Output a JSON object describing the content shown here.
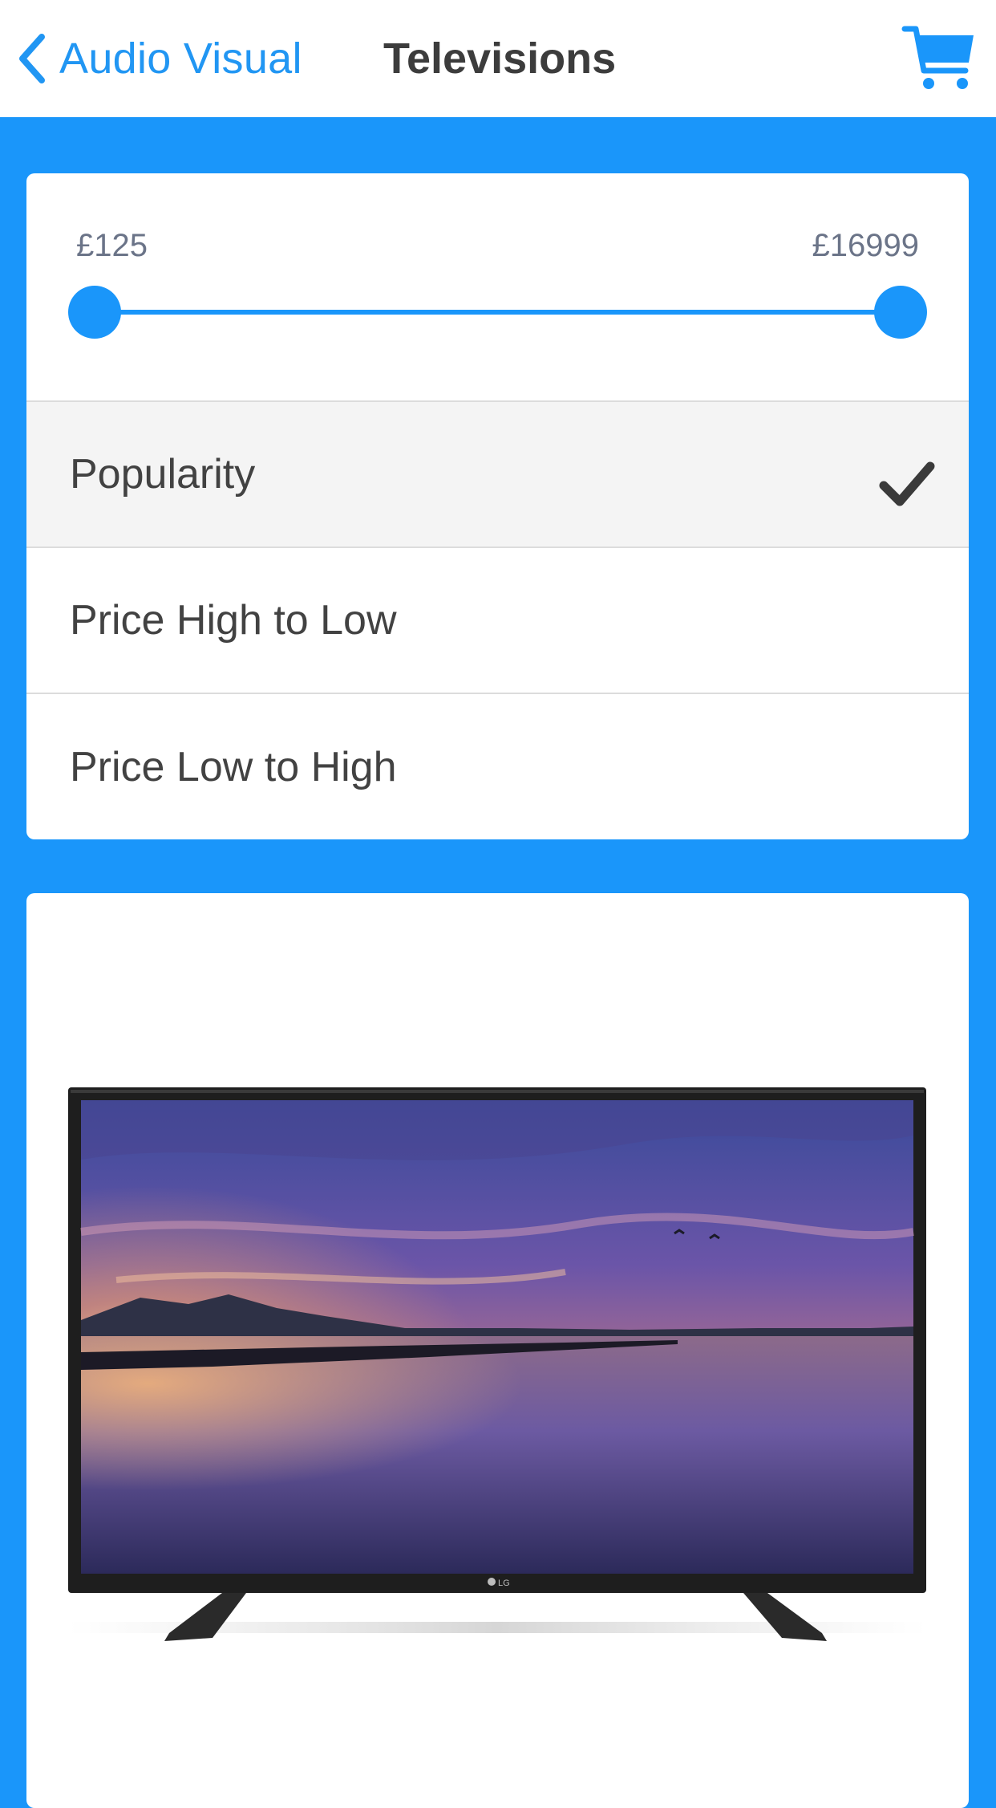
{
  "header": {
    "back_label": "Audio Visual",
    "title": "Televisions",
    "back_icon": "chevron-left-icon",
    "cart_icon": "shopping-cart-icon",
    "accent_color": "#2196f3"
  },
  "price_filter": {
    "min_label": "£125",
    "max_label": "£16999",
    "selected_min_fraction": 0.0,
    "selected_max_fraction": 1.0
  },
  "sort": {
    "options": [
      {
        "label": "Popularity",
        "selected": true
      },
      {
        "label": "Price High to Low",
        "selected": false
      },
      {
        "label": "Price Low to High",
        "selected": false
      }
    ],
    "selected_icon": "checkmark-icon"
  },
  "product": {
    "image": "lg-television-image",
    "logo_text": "LG"
  },
  "colors": {
    "background": "#1a96fa",
    "card": "#ffffff",
    "selected_row": "#f4f4f4"
  }
}
